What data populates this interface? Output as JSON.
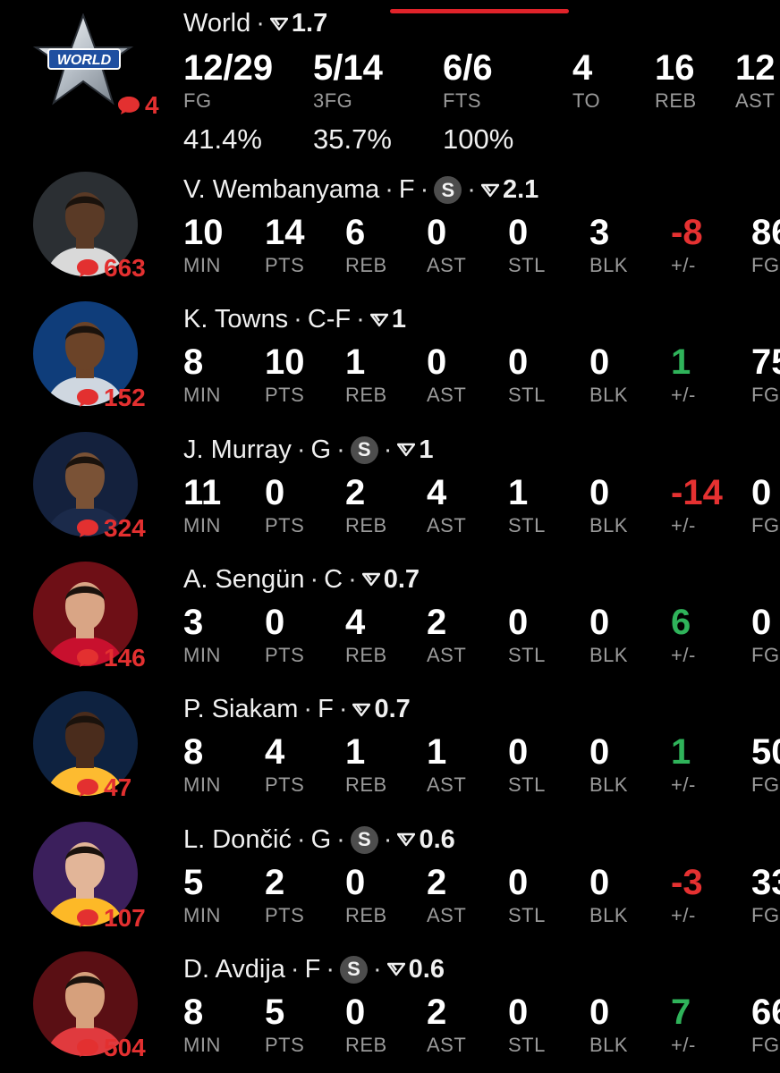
{
  "team": {
    "logo_text": "WORLD",
    "name": "World",
    "rating": "1.7",
    "comments": "4",
    "stats": [
      {
        "value": "12/29",
        "label": "FG"
      },
      {
        "value": "5/14",
        "label": "3FG"
      },
      {
        "value": "6/6",
        "label": "FTS"
      },
      {
        "value": "4",
        "label": "TO"
      },
      {
        "value": "16",
        "label": "REB"
      },
      {
        "value": "12",
        "label": "AST"
      }
    ],
    "percentages": [
      "41.4%",
      "35.7%",
      "100%"
    ]
  },
  "players": [
    {
      "name": "V. Wembanyama",
      "position": "F",
      "starter": true,
      "starter_label": "S",
      "rating": "2.1",
      "comments": "663",
      "avatar_bg": "#2b2f33",
      "skin": "#5a3a26",
      "jersey": "#d9d9d9",
      "stats": [
        {
          "value": "10",
          "label": "MIN"
        },
        {
          "value": "14",
          "label": "PTS"
        },
        {
          "value": "6",
          "label": "REB"
        },
        {
          "value": "0",
          "label": "AST"
        },
        {
          "value": "0",
          "label": "STL"
        },
        {
          "value": "3",
          "label": "BLK"
        },
        {
          "value": "-8",
          "label": "+/-",
          "tone": "neg"
        },
        {
          "value": "86",
          "label": "FG"
        }
      ]
    },
    {
      "name": "K. Towns",
      "position": "C-F",
      "starter": false,
      "rating": "1",
      "comments": "152",
      "avatar_bg": "#0f3d7a",
      "skin": "#6b4328",
      "jersey": "#cfd7e0",
      "stats": [
        {
          "value": "8",
          "label": "MIN"
        },
        {
          "value": "10",
          "label": "PTS"
        },
        {
          "value": "1",
          "label": "REB"
        },
        {
          "value": "0",
          "label": "AST"
        },
        {
          "value": "0",
          "label": "STL"
        },
        {
          "value": "0",
          "label": "BLK"
        },
        {
          "value": "1",
          "label": "+/-",
          "tone": "pos"
        },
        {
          "value": "75",
          "label": "FG"
        }
      ]
    },
    {
      "name": "J. Murray",
      "position": "G",
      "starter": true,
      "starter_label": "S",
      "rating": "1",
      "comments": "324",
      "avatar_bg": "#14213d",
      "skin": "#7a5236",
      "jersey": "#1b2a4a",
      "stats": [
        {
          "value": "11",
          "label": "MIN"
        },
        {
          "value": "0",
          "label": "PTS"
        },
        {
          "value": "2",
          "label": "REB"
        },
        {
          "value": "4",
          "label": "AST"
        },
        {
          "value": "1",
          "label": "STL"
        },
        {
          "value": "0",
          "label": "BLK"
        },
        {
          "value": "-14",
          "label": "+/-",
          "tone": "neg"
        },
        {
          "value": "0",
          "label": "FG"
        }
      ]
    },
    {
      "name": "A. Sengün",
      "position": "C",
      "starter": false,
      "rating": "0.7",
      "comments": "146",
      "avatar_bg": "#6e0f16",
      "skin": "#d9a585",
      "jersey": "#c8102e",
      "stats": [
        {
          "value": "3",
          "label": "MIN"
        },
        {
          "value": "0",
          "label": "PTS"
        },
        {
          "value": "4",
          "label": "REB"
        },
        {
          "value": "2",
          "label": "AST"
        },
        {
          "value": "0",
          "label": "STL"
        },
        {
          "value": "0",
          "label": "BLK"
        },
        {
          "value": "6",
          "label": "+/-",
          "tone": "pos"
        },
        {
          "value": "0",
          "label": "FG"
        }
      ]
    },
    {
      "name": "P. Siakam",
      "position": "F",
      "starter": false,
      "rating": "0.7",
      "comments": "47",
      "avatar_bg": "#0e2240",
      "skin": "#4a2c1c",
      "jersey": "#fdbb30",
      "stats": [
        {
          "value": "8",
          "label": "MIN"
        },
        {
          "value": "4",
          "label": "PTS"
        },
        {
          "value": "1",
          "label": "REB"
        },
        {
          "value": "1",
          "label": "AST"
        },
        {
          "value": "0",
          "label": "STL"
        },
        {
          "value": "0",
          "label": "BLK"
        },
        {
          "value": "1",
          "label": "+/-",
          "tone": "pos"
        },
        {
          "value": "50",
          "label": "FG"
        }
      ]
    },
    {
      "name": "L. Dončić",
      "position": "G",
      "starter": true,
      "starter_label": "S",
      "rating": "0.6",
      "comments": "107",
      "avatar_bg": "#3b1f5c",
      "skin": "#e2b598",
      "jersey": "#fdb927",
      "stats": [
        {
          "value": "5",
          "label": "MIN"
        },
        {
          "value": "2",
          "label": "PTS"
        },
        {
          "value": "0",
          "label": "REB"
        },
        {
          "value": "2",
          "label": "AST"
        },
        {
          "value": "0",
          "label": "STL"
        },
        {
          "value": "0",
          "label": "BLK"
        },
        {
          "value": "-3",
          "label": "+/-",
          "tone": "neg"
        },
        {
          "value": "33",
          "label": "FG"
        }
      ]
    },
    {
      "name": "D. Avdija",
      "position": "F",
      "starter": true,
      "starter_label": "S",
      "rating": "0.6",
      "comments": "504",
      "avatar_bg": "#5a0f14",
      "skin": "#d6a07c",
      "jersey": "#e03a3e",
      "stats": [
        {
          "value": "8",
          "label": "MIN"
        },
        {
          "value": "5",
          "label": "PTS"
        },
        {
          "value": "0",
          "label": "REB"
        },
        {
          "value": "2",
          "label": "AST"
        },
        {
          "value": "0",
          "label": "STL"
        },
        {
          "value": "0",
          "label": "BLK"
        },
        {
          "value": "7",
          "label": "+/-",
          "tone": "pos"
        },
        {
          "value": "66",
          "label": "FG"
        }
      ]
    }
  ],
  "icons": {
    "comment": "speech-bubble-icon",
    "rating": "rating-arrow-icon"
  },
  "colors": {
    "accent": "#e0232a",
    "positive": "#2fb35a",
    "negative": "#e53131",
    "label_gray": "#9a9a9a"
  }
}
